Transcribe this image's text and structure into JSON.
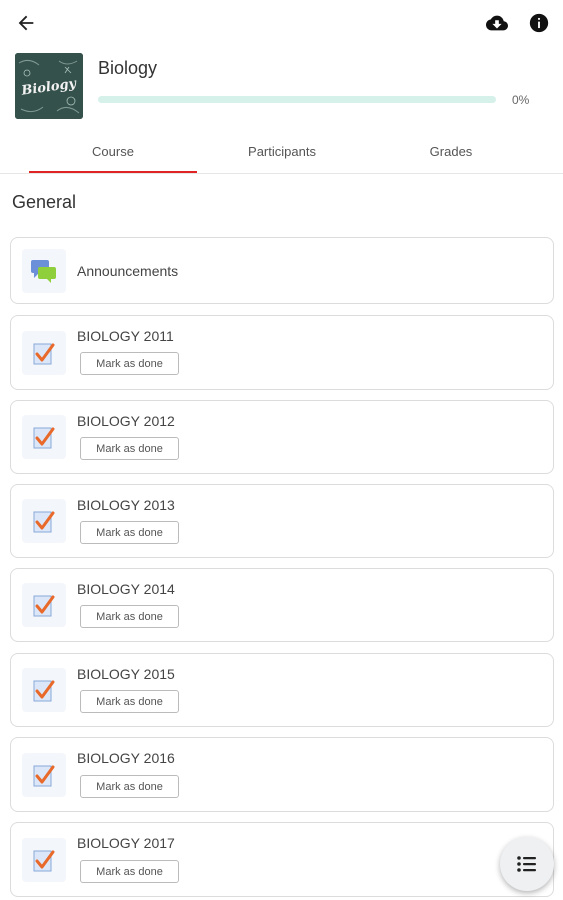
{
  "header": {
    "back_icon": "arrow-left-icon",
    "download_icon": "cloud-download-icon",
    "info_icon": "info-icon"
  },
  "course": {
    "title": "Biology",
    "thumbnail_text": "Biology",
    "progress_percent": 0,
    "progress_label": "0%"
  },
  "tabs": [
    {
      "label": "Course",
      "active": true
    },
    {
      "label": "Participants",
      "active": false
    },
    {
      "label": "Grades",
      "active": false
    }
  ],
  "section": {
    "title": "General"
  },
  "modules": [
    {
      "title": "Announcements",
      "type": "forum",
      "icon": "forum-icon"
    },
    {
      "title": "BIOLOGY 2011",
      "type": "assignment",
      "icon": "assignment-icon",
      "button": "Mark as done"
    },
    {
      "title": "BIOLOGY 2012",
      "type": "assignment",
      "icon": "assignment-icon",
      "button": "Mark as done"
    },
    {
      "title": "BIOLOGY 2013",
      "type": "assignment",
      "icon": "assignment-icon",
      "button": "Mark as done"
    },
    {
      "title": "BIOLOGY 2014",
      "type": "assignment",
      "icon": "assignment-icon",
      "button": "Mark as done"
    },
    {
      "title": "BIOLOGY 2015",
      "type": "assignment",
      "icon": "assignment-icon",
      "button": "Mark as done"
    },
    {
      "title": "BIOLOGY 2016",
      "type": "assignment",
      "icon": "assignment-icon",
      "button": "Mark as done"
    },
    {
      "title": "BIOLOGY 2017",
      "type": "assignment",
      "icon": "assignment-icon",
      "button": "Mark as done"
    }
  ],
  "fab": {
    "icon": "list-icon"
  },
  "colors": {
    "accent_tab": "#e02424",
    "progress_track": "#d5f1ea",
    "check": "#e8692a"
  }
}
